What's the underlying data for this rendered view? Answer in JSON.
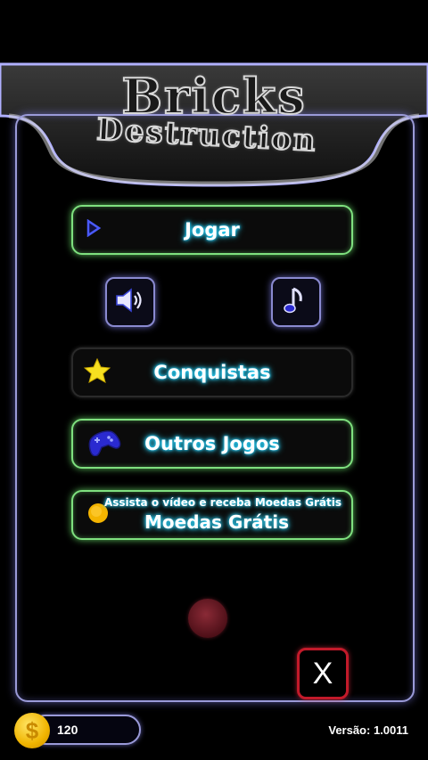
{
  "title": {
    "line1": "Bricks",
    "line2": "Destruction"
  },
  "menu": {
    "play_label": "Jogar",
    "achievements_label": "Conquistas",
    "other_games_label": "Outros Jogos",
    "free_coins_caption": "Assista o vídeo e receba Moedas Grátis",
    "free_coins_label": "Moedas Grátis"
  },
  "close_label": "X",
  "footer": {
    "coin_symbol": "$",
    "coin_count": "120",
    "version": "Versão: 1.0011"
  },
  "colors": {
    "button_glow": "#7fe07f",
    "frame": "#9a9ad8",
    "label_glow": "#2fd8ff",
    "close_border": "#c21a2a",
    "coin": "#f0b400"
  },
  "icons": {
    "play": "play-icon",
    "sound": "speaker-icon",
    "music": "music-note-icon",
    "achievements": "star-icon",
    "other_games": "gamepad-icon",
    "coins": "coin-icon"
  }
}
